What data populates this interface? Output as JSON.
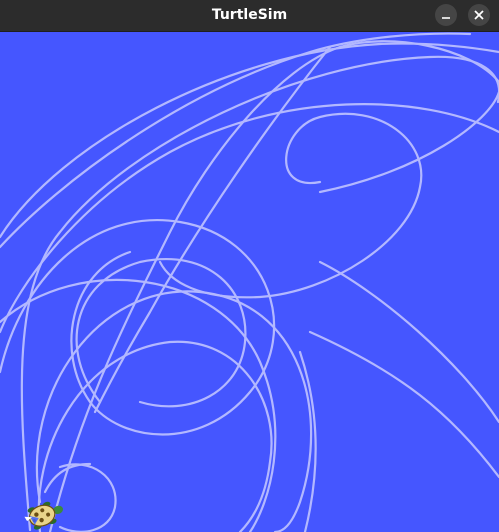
{
  "window": {
    "title": "TurtleSim",
    "minimize_icon": "minimize-icon",
    "close_icon": "close-icon"
  },
  "canvas": {
    "background_color": "#4556ff",
    "pen_color": "#b3b8ff",
    "turtle_icon": "turtle-icon"
  }
}
